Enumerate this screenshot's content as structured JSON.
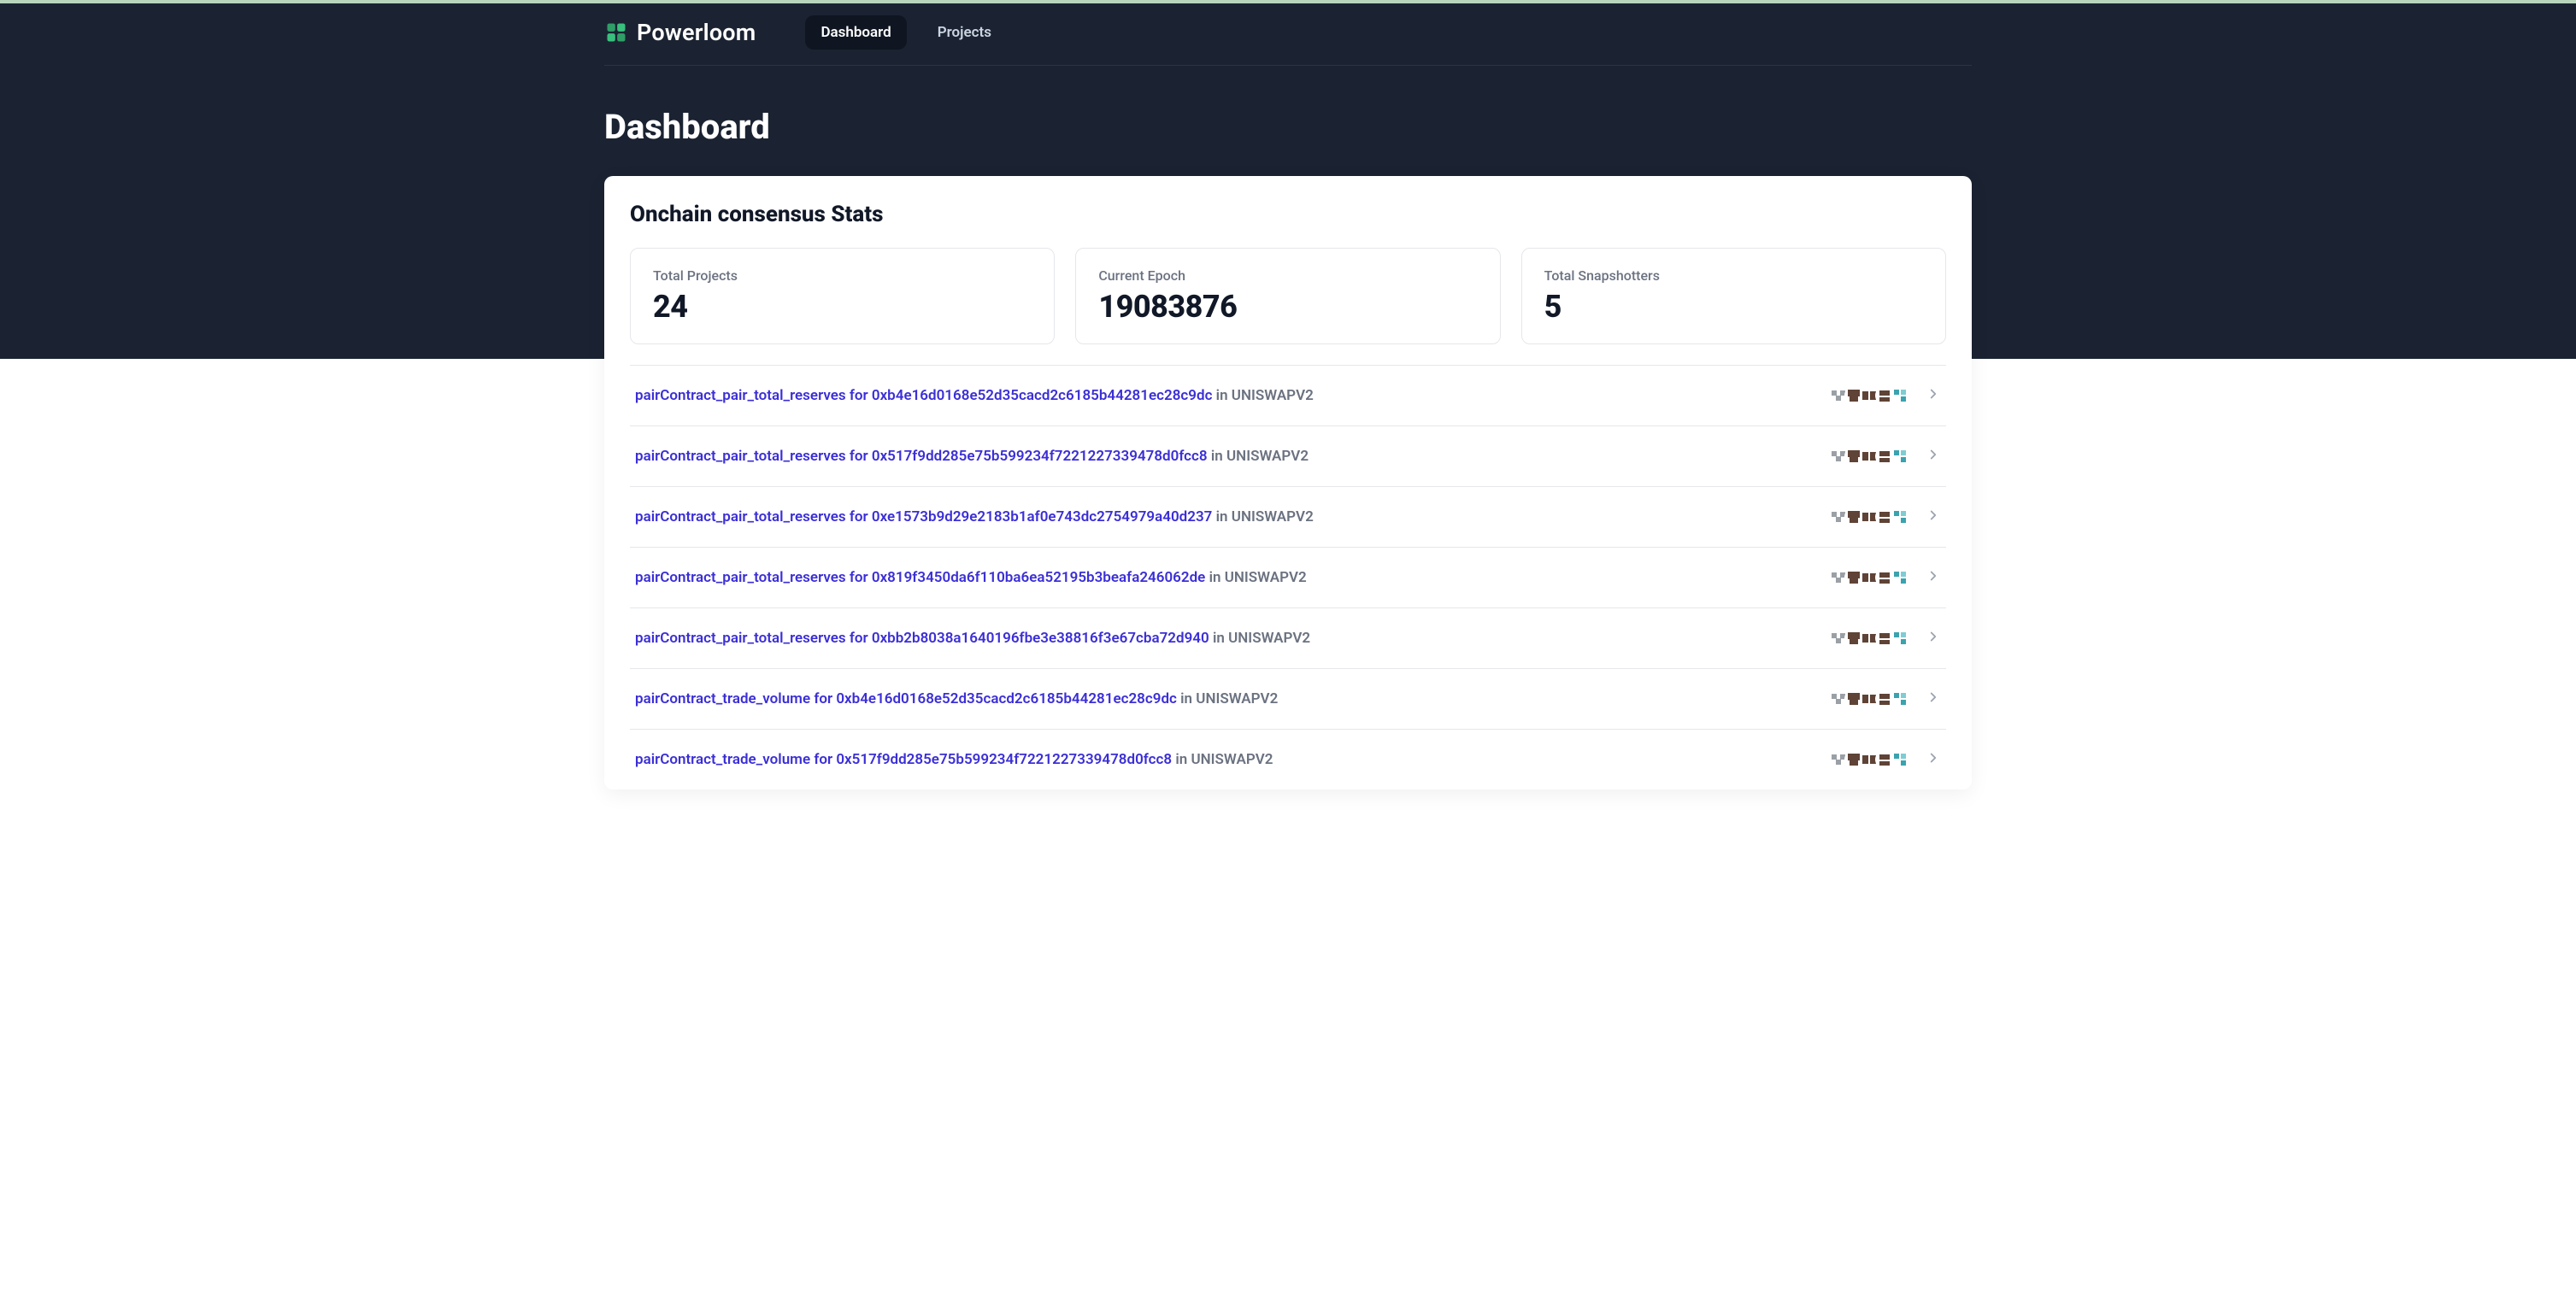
{
  "brand": "Powerloom",
  "nav": {
    "tabs": [
      {
        "label": "Dashboard",
        "active": true
      },
      {
        "label": "Projects",
        "active": false
      }
    ]
  },
  "page_title": "Dashboard",
  "card": {
    "title": "Onchain consensus Stats",
    "stats": [
      {
        "label": "Total Projects",
        "value": "24"
      },
      {
        "label": "Current Epoch",
        "value": "19083876"
      },
      {
        "label": "Total Snapshotters",
        "value": "5"
      }
    ],
    "rows": [
      {
        "link_text": "pairContract_pair_total_reserves for 0xb4e16d0168e52d35cacd2c6185b44281ec28c9dc",
        "suffix": " in UNISWAPV2"
      },
      {
        "link_text": "pairContract_pair_total_reserves for 0x517f9dd285e75b599234f7221227339478d0fcc8",
        "suffix": " in UNISWAPV2"
      },
      {
        "link_text": "pairContract_pair_total_reserves for 0xe1573b9d29e2183b1af0e743dc2754979a40d237",
        "suffix": " in UNISWAPV2"
      },
      {
        "link_text": "pairContract_pair_total_reserves for 0x819f3450da6f110ba6ea52195b3beafa246062de",
        "suffix": " in UNISWAPV2"
      },
      {
        "link_text": "pairContract_pair_total_reserves for 0xbb2b8038a1640196fbe3e38816f3e67cba72d940",
        "suffix": " in UNISWAPV2"
      },
      {
        "link_text": "pairContract_trade_volume for 0xb4e16d0168e52d35cacd2c6185b44281ec28c9dc",
        "suffix": " in UNISWAPV2"
      },
      {
        "link_text": "pairContract_trade_volume for 0x517f9dd285e75b599234f7221227339478d0fcc8",
        "suffix": " in UNISWAPV2"
      }
    ]
  },
  "colors": {
    "brand_accent": "#39c07d",
    "link": "#3b2fd6",
    "muted": "#6b7280",
    "identicon_brown": "#5f4336",
    "identicon_gray": "#9aa0a6",
    "identicon_teal": "#3aa3ae"
  }
}
